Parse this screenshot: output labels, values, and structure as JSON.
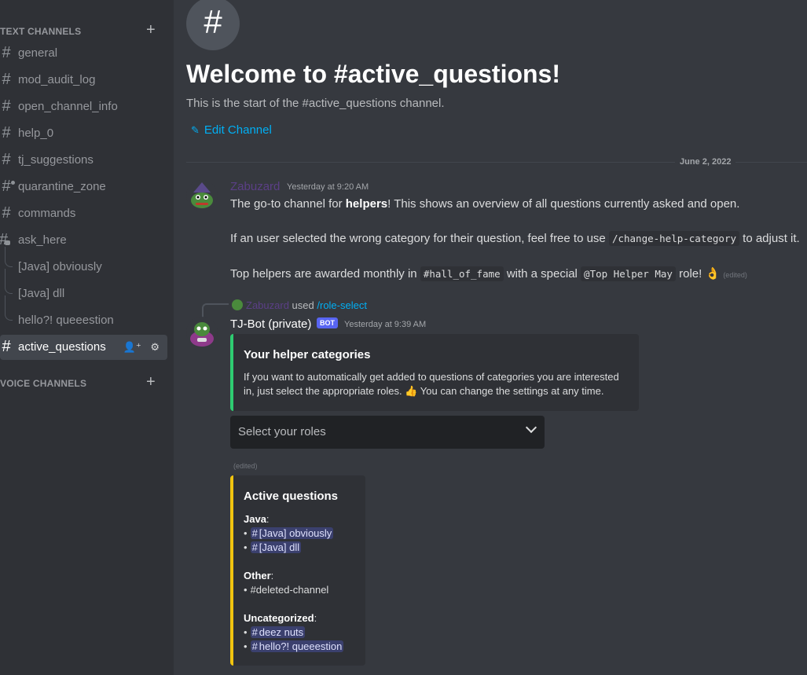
{
  "sidebar": {
    "text_category": "TEXT CHANNELS",
    "voice_category": "VOICE CHANNELS",
    "channels": [
      {
        "name": "general"
      },
      {
        "name": "mod_audit_log"
      },
      {
        "name": "open_channel_info"
      },
      {
        "name": "help_0"
      },
      {
        "name": "tj_suggestions"
      },
      {
        "name": "quarantine_zone"
      },
      {
        "name": "commands"
      },
      {
        "name": "ask_here"
      }
    ],
    "threads": [
      {
        "name": "[Java] obviously"
      },
      {
        "name": "[Java] dll"
      },
      {
        "name": "hello?! queeestion"
      }
    ],
    "active_channel": "active_questions"
  },
  "main": {
    "welcome_title": "Welcome to #active_questions!",
    "welcome_sub": "This is the start of the #active_questions channel.",
    "edit_channel": "Edit Channel",
    "date_divider": "June 2, 2022"
  },
  "messages": {
    "m1": {
      "author": "Zabuzard",
      "author_color": "#5b3f86",
      "timestamp": "Yesterday at 9:20 AM",
      "line1_pre": "The go-to channel for ",
      "line1_bold": "helpers",
      "line1_post": "! This shows an overview of all questions currently asked and open.",
      "line2_pre": "If an user selected the wrong category for their question, feel free to use ",
      "line2_code": "/change-help-category",
      "line2_post": " to adjust it.",
      "line3_pre": "Top helpers are awarded monthly in ",
      "line3_code1": "#hall_of_fame",
      "line3_mid": " with a special ",
      "line3_code2": "@Top Helper May",
      "line3_post": " role! 👌",
      "edited": "(edited)"
    },
    "m2": {
      "reply_user": "Zabuzard",
      "reply_used": "used",
      "reply_cmd": "/role-select",
      "author": "TJ-Bot (private)",
      "bot_badge": "BOT",
      "timestamp": "Yesterday at 9:39 AM",
      "embed_title": "Your helper categories",
      "embed_desc_1": "If you want to automatically get added to questions of categories you are interested",
      "embed_desc_2": "in, just select the appropriate roles. 👍 You can change the settings at any time.",
      "select_placeholder": "Select your roles",
      "edited": "(edited)",
      "questions_title": "Active questions",
      "java_label": "Java",
      "java_items": [
        "[Java] obviously",
        "[Java] dll"
      ],
      "other_label": "Other",
      "other_items": [
        "#deleted-channel"
      ],
      "uncat_label": "Uncategorized",
      "uncat_items": [
        "deez nuts",
        "hello?! queeestion"
      ]
    }
  },
  "colors": {
    "embed1_border": "#2ecc71",
    "embed2_border": "#f1c40f",
    "link": "#00aff4",
    "bot_badge": "#5865f2"
  }
}
